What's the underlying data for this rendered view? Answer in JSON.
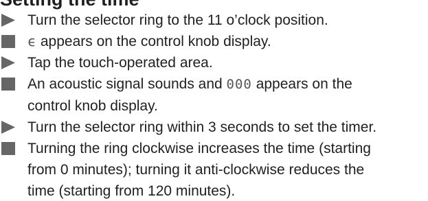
{
  "heading": "Setting the time",
  "steps": [
    {
      "kind": "action",
      "text": "Turn the selector ring to the 11 o’clock position."
    },
    {
      "kind": "result",
      "symbol": "ϵ",
      "text": " appears on the control knob display."
    },
    {
      "kind": "action",
      "text": "Tap the touch-operated area."
    },
    {
      "kind": "result",
      "before": "An acoustic signal sounds and ",
      "symbol": "000",
      "after": " appears on the",
      "cont": "control knob display."
    },
    {
      "kind": "action",
      "text": "Turn the selector ring within 3 seconds to set the timer."
    },
    {
      "kind": "result",
      "line1": "Turning the ring clockwise increases the time (starting",
      "line2": "from 0 minutes); turning it anti-clockwise reduces the",
      "line3": "time (starting from 120 minutes)."
    }
  ],
  "colors": {
    "text": "#1f1f1f",
    "marker": "#666666"
  },
  "icons": {
    "action": "play-triangle-icon",
    "result": "filled-square-icon"
  }
}
